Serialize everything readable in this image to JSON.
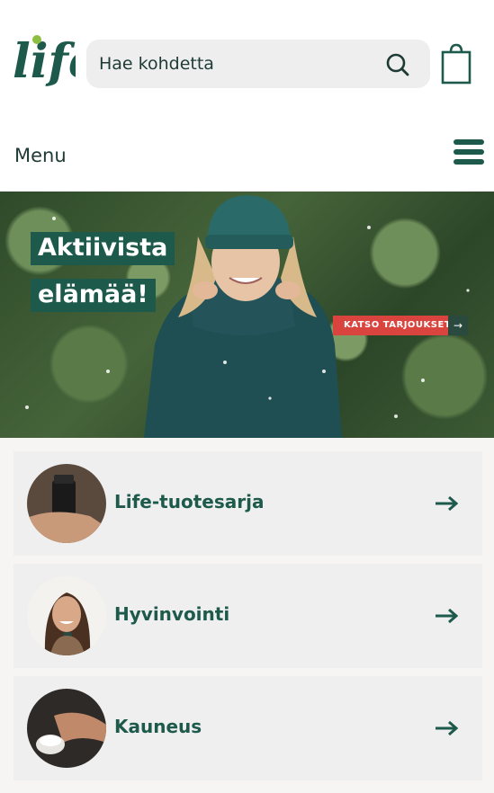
{
  "header": {
    "logo_text": "life",
    "search_placeholder": "Hae kohdetta"
  },
  "menu": {
    "label": "Menu"
  },
  "hero": {
    "headline_line1": "Aktiivista",
    "headline_line2": "elämää!",
    "cta_label": "KATSO TARJOUKSET!"
  },
  "categories": [
    {
      "label": "Life-tuotesarja"
    },
    {
      "label": "Hyvinvointi"
    },
    {
      "label": "Kauneus"
    }
  ],
  "colors": {
    "brand_green": "#1e5a4c",
    "cta_red": "#d9453e",
    "card_bg": "#efefef"
  }
}
